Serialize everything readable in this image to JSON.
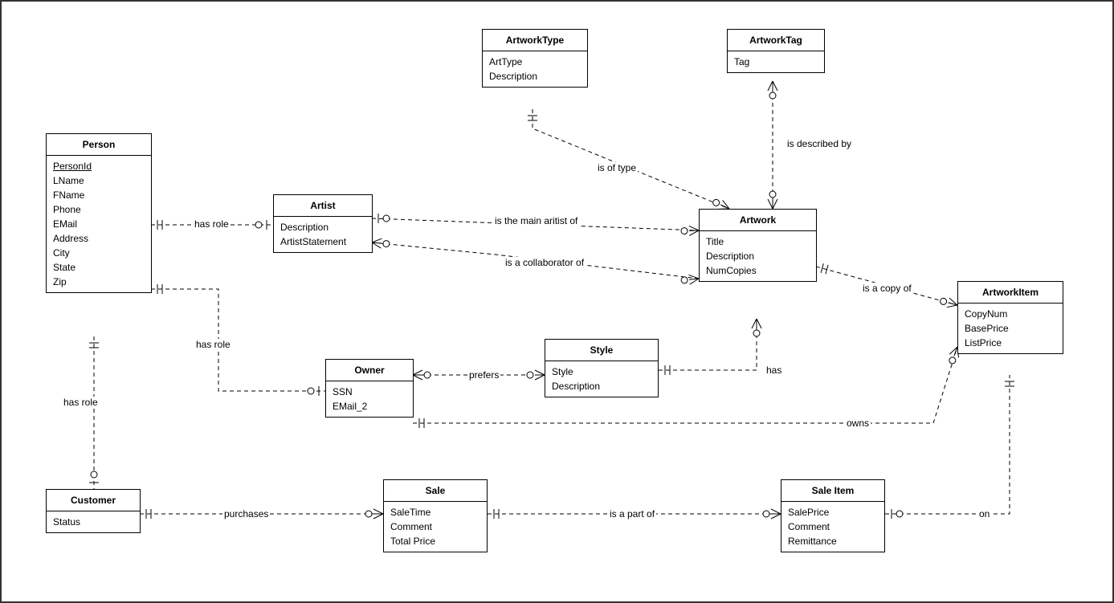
{
  "entities": {
    "person": {
      "title": "Person",
      "attrs": [
        "PersonId",
        "LName",
        "FName",
        "Phone",
        "EMail",
        "Address",
        "City",
        "State",
        "Zip"
      ]
    },
    "artist": {
      "title": "Artist",
      "attrs": [
        "Description",
        "ArtistStatement"
      ]
    },
    "artworktype": {
      "title": "ArtworkType",
      "attrs": [
        "ArtType",
        "Description"
      ]
    },
    "artworktag": {
      "title": "ArtworkTag",
      "attrs": [
        "Tag"
      ]
    },
    "artwork": {
      "title": "Artwork",
      "attrs": [
        "Title",
        "Description",
        "NumCopies"
      ]
    },
    "artworkitem": {
      "title": "ArtworkItem",
      "attrs": [
        "CopyNum",
        "BasePrice",
        "ListPrice"
      ]
    },
    "owner": {
      "title": "Owner",
      "attrs": [
        "SSN",
        "EMail_2"
      ]
    },
    "style": {
      "title": "Style",
      "attrs": [
        "Style",
        "Description"
      ]
    },
    "customer": {
      "title": "Customer",
      "attrs": [
        "Status"
      ]
    },
    "sale": {
      "title": "Sale",
      "attrs": [
        "SaleTime",
        "Comment",
        "Total Price"
      ]
    },
    "saleitem": {
      "title": "Sale Item",
      "attrs": [
        "SalePrice",
        "Comment",
        "Remittance"
      ]
    }
  },
  "relations": {
    "hasrole1": "has role",
    "hasrole2": "has role",
    "hasrole3": "has role",
    "isoftype": "is of type",
    "isdescribedby": "is described by",
    "ismainartist": "is the main aritist of",
    "iscollaborator": "is a collaborator of",
    "iscopyof": "is a copy of",
    "prefers": "prefers",
    "has": "has",
    "owns": "owns",
    "purchases": "purchases",
    "ispartof": "is a part of",
    "on": "on"
  }
}
